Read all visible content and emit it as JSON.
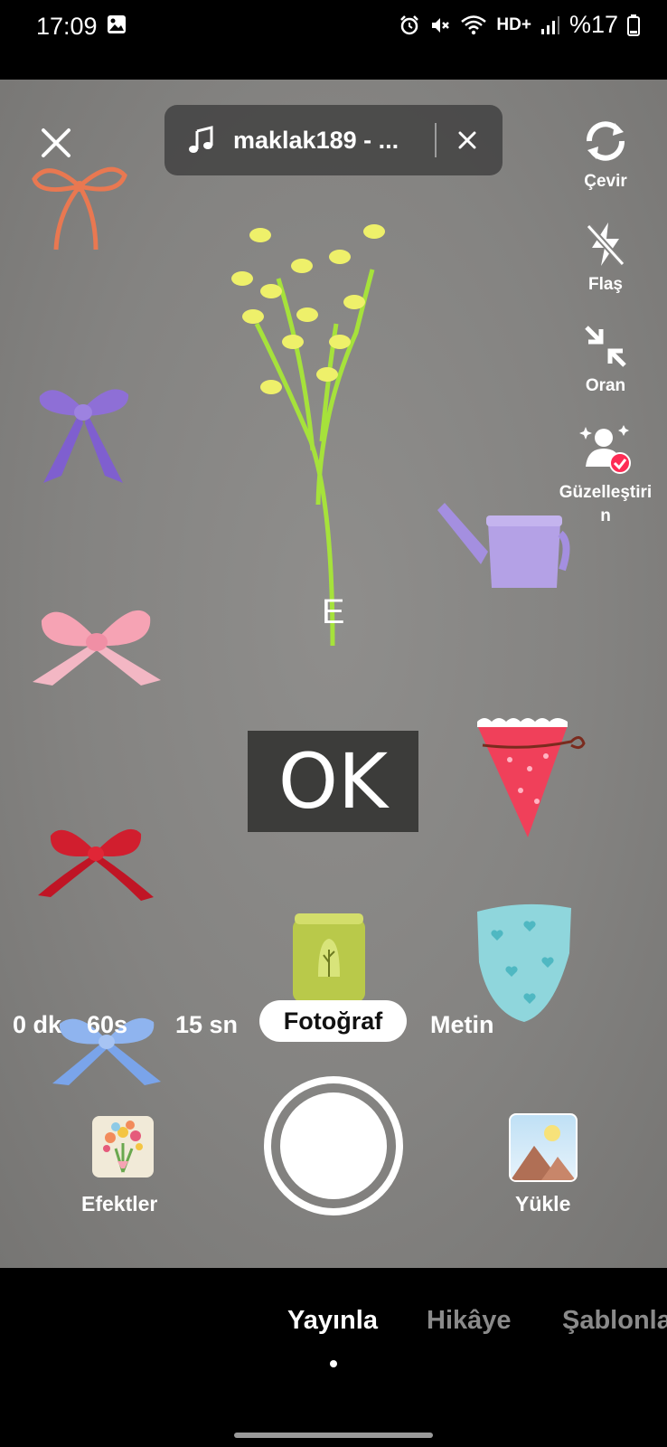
{
  "status_bar": {
    "time": "17:09",
    "battery": "%17",
    "network": "HD+"
  },
  "music": {
    "title": "maklak189 - ..."
  },
  "side_tools": [
    {
      "label": "Çevir",
      "icon": "flip-camera-icon"
    },
    {
      "label": "Flaş",
      "icon": "flash-off-icon"
    },
    {
      "label": "Oran",
      "icon": "ratio-icon"
    },
    {
      "label": "Güzelleştiri\nn",
      "icon": "beautify-icon"
    }
  ],
  "canvas": {
    "letter": "E",
    "ok_text": "OK"
  },
  "modes": [
    {
      "label": "0 dk"
    },
    {
      "label": "60s"
    },
    {
      "label": "15 sn"
    },
    {
      "label": "Fotoğraf",
      "active": true
    },
    {
      "label": "Metin"
    }
  ],
  "bottom": {
    "effects_label": "Efektler",
    "upload_label": "Yükle"
  },
  "nav": {
    "tabs": [
      "Yayınla",
      "Hikâye",
      "Şablonla"
    ],
    "active_index": 0
  },
  "colors": {
    "active_tab": "#ffffff",
    "inactive_tab": "#8a8a8a",
    "badge": "#fe2c55"
  }
}
